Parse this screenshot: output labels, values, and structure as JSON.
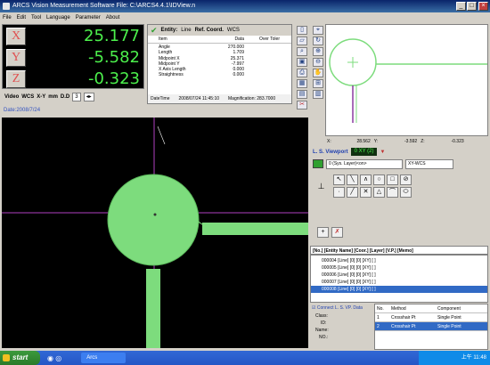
{
  "window": {
    "title": "ARCS Vision Measurement Software        File: C:\\ARCS4.4.1\\IDView.n"
  },
  "menu": [
    "File",
    "Edit",
    "Tool",
    "Language",
    "Parameter",
    "About"
  ],
  "dro": {
    "x_label": "X",
    "x_value": "25.177",
    "y_label": "Y",
    "y_value": "-5.582",
    "z_label": "Z",
    "z_value": "-0.323"
  },
  "dro_toolbar": {
    "video": "Video",
    "wcs": "WCS",
    "plane": "X-Y",
    "unit": "mm",
    "dd": "D.D",
    "decimals": "3"
  },
  "entity": {
    "tab_entity": "Entity:",
    "type": "Line",
    "ref": "Ref. Coord.",
    "wcs": "WCS",
    "headers": [
      "Item",
      "Data",
      "Over Toler"
    ],
    "rows": [
      {
        "item": "Angle",
        "data": "270.000"
      },
      {
        "item": "Length",
        "data": "1.709"
      },
      {
        "item": "Midpoint X",
        "data": "25.371"
      },
      {
        "item": "Midpoint Y",
        "data": "-7.997"
      },
      {
        "item": "X Axis Length",
        "data": "0.000"
      },
      {
        "item": "Straightness",
        "data": "0.000"
      }
    ],
    "datetime_label": "DateTime",
    "datetime": "2008/07/24 11:45:10",
    "magnification": "Magnification: 283.7000"
  },
  "coords": {
    "x_label": "X:",
    "x": "28.562",
    "y_label": "Y:",
    "y": "-3.592",
    "z_label": "Z:",
    "z": "-0.323"
  },
  "viewport": {
    "label": "L. S. Viewport",
    "value": "0 XY (2)"
  },
  "layer": {
    "value": "0 (Sys. Layer)<on>",
    "coord": "XY-WCS"
  },
  "list": {
    "header": "[No.] [Entity Name] [Coor.] [Layer] [V.P.] [Memo]",
    "rows": [
      "000004 [Line] [0] [0] [XY] [ ]",
      "000005 [Line] [0] [0] [XY] [ ]",
      "000006 [Line] [0] [0] [XY] [ ]",
      "000007 [Line] [0] [0] [XY] [ ]",
      "000008 [Line] [0] [0] [XY] [ ]"
    ]
  },
  "bottom": {
    "connect": "Connect L. S. VP. Data",
    "class": "Class:",
    "id": "ID:",
    "name": "Name:",
    "no": "NO.:"
  },
  "methods": {
    "headers": [
      "No.",
      "Method",
      "Component"
    ],
    "rows": [
      {
        "no": "1",
        "method": "Crosshair Pt",
        "component": "Single Point"
      },
      {
        "no": "2",
        "method": "Crosshair Pt",
        "component": "Single Point"
      }
    ]
  },
  "image": {
    "date": "Date:2008/7/24"
  },
  "taskbar": {
    "start": "start",
    "task": "Arcs",
    "clock": "上午 11:48"
  },
  "colors": {
    "dro_green": "#4cf04c",
    "measure_green": "#7ddc7d",
    "accent_blue": "#316ac5"
  }
}
